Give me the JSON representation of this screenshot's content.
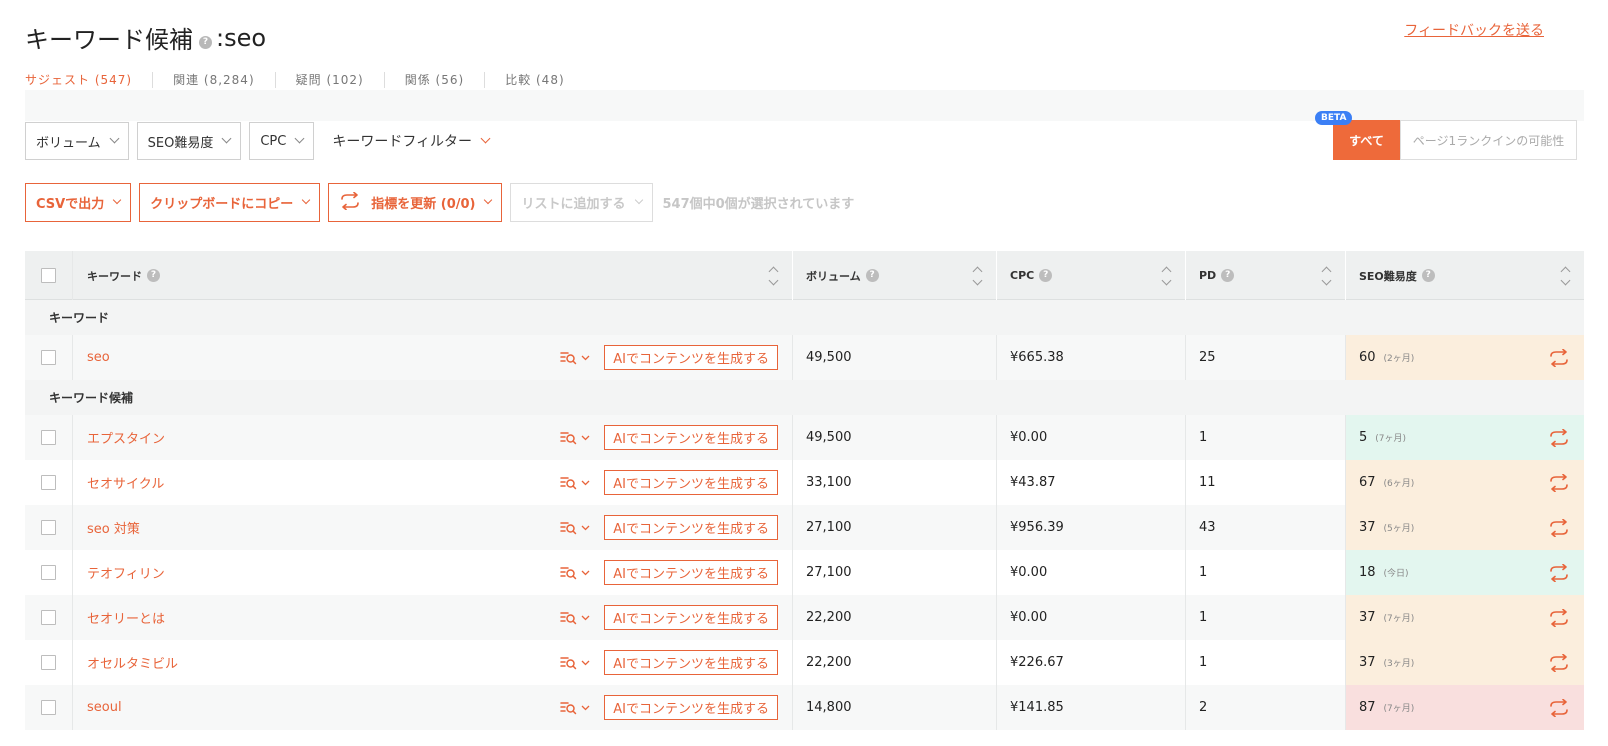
{
  "header": {
    "title": "キーワード候補",
    "help": "?",
    "query": ":seo",
    "feedback_link": "フィードバックを送る"
  },
  "tabs": [
    {
      "label": "サジェスト (547)"
    },
    {
      "label": "関連 (8,284)"
    },
    {
      "label": "疑問 (102)"
    },
    {
      "label": "関係 (56)"
    },
    {
      "label": "比較 (48)"
    }
  ],
  "filters": {
    "volume": "ボリューム",
    "seo_difficulty": "SEO難易度",
    "cpc": "CPC",
    "keyword_filter": "キーワードフィルター"
  },
  "segmented": {
    "beta": "BETA",
    "all": "すべて",
    "rank_possibility": "ページ1ランクインの可能性"
  },
  "actions": {
    "csv": "CSVで出力",
    "clipboard": "クリップボードにコピー",
    "update_metrics": "指標を更新 (0/0)",
    "add_to_list": "リストに追加する",
    "selected_count": "547個中0個が選択されています"
  },
  "table": {
    "columns": {
      "keyword": "キーワード",
      "volume": "ボリューム",
      "cpc": "CPC",
      "pd": "PD",
      "seo": "SEO難易度",
      "help": "?"
    },
    "ai_button": "AIでコンテンツを生成する",
    "groups": {
      "keyword": "キーワード",
      "candidates": "キーワード候補"
    },
    "main_row": {
      "keyword": "seo",
      "volume": "49,500",
      "cpc": "¥665.38",
      "pd": "25",
      "seo": "60",
      "age": "(2ヶ月)",
      "level": "orange"
    },
    "rows": [
      {
        "keyword": "エプスタイン",
        "volume": "49,500",
        "cpc": "¥0.00",
        "pd": "1",
        "seo": "5",
        "age": "(7ヶ月)",
        "level": "green"
      },
      {
        "keyword": "セオサイクル",
        "volume": "33,100",
        "cpc": "¥43.87",
        "pd": "11",
        "seo": "67",
        "age": "(6ヶ月)",
        "level": "orange"
      },
      {
        "keyword": "seo 対策",
        "volume": "27,100",
        "cpc": "¥956.39",
        "pd": "43",
        "seo": "37",
        "age": "(5ヶ月)",
        "level": "orange"
      },
      {
        "keyword": "テオフィリン",
        "volume": "27,100",
        "cpc": "¥0.00",
        "pd": "1",
        "seo": "18",
        "age": "(今日)",
        "level": "green"
      },
      {
        "keyword": "セオリーとは",
        "volume": "22,200",
        "cpc": "¥0.00",
        "pd": "1",
        "seo": "37",
        "age": "(7ヶ月)",
        "level": "orange"
      },
      {
        "keyword": "オセルタミビル",
        "volume": "22,200",
        "cpc": "¥226.67",
        "pd": "1",
        "seo": "37",
        "age": "(3ヶ月)",
        "level": "orange"
      },
      {
        "keyword": "seoul",
        "volume": "14,800",
        "cpc": "¥141.85",
        "pd": "2",
        "seo": "87",
        "age": "(7ヶ月)",
        "level": "red"
      }
    ]
  },
  "colors": {
    "accent": "#e8643a",
    "seo_orange": "#fbeedd",
    "seo_green": "#e3f6ef",
    "seo_red": "#f9dfde",
    "beta": "#3b7ff5"
  }
}
